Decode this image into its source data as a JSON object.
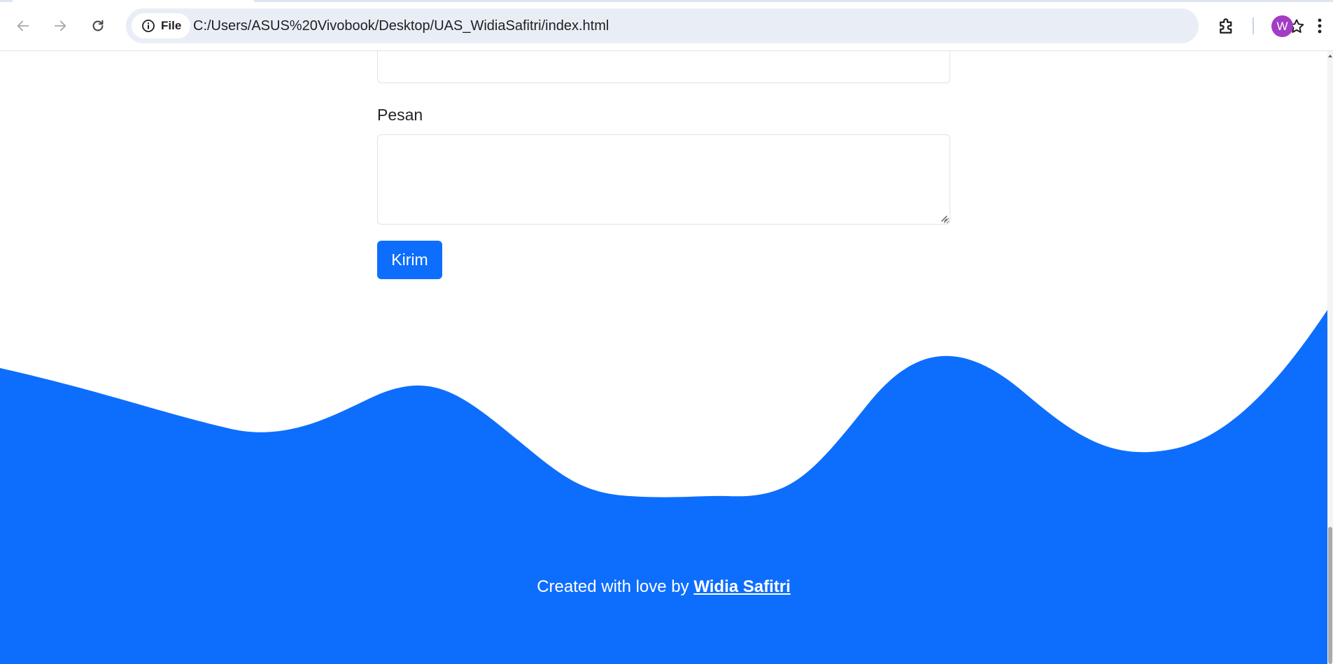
{
  "browser": {
    "nav_back_icon": "arrow-left-icon",
    "nav_forward_icon": "arrow-right-icon",
    "reload_icon": "reload-icon",
    "site_info_label": "File",
    "url": "C:/Users/ASUS%20Vivobook/Desktop/UAS_WidiaSafitri/index.html",
    "bookmark_icon": "star-icon",
    "extensions_icon": "puzzle-icon",
    "profile_initial": "W",
    "menu_icon": "kebab-menu-icon"
  },
  "form": {
    "message_label": "Pesan",
    "message_value": "",
    "submit_label": "Kirim"
  },
  "footer": {
    "text": "Created with love by ",
    "author": "Widia Safitri"
  },
  "colors": {
    "primary": "#0d6efd",
    "avatar": "#a23dc4",
    "background": "#ffffff"
  }
}
